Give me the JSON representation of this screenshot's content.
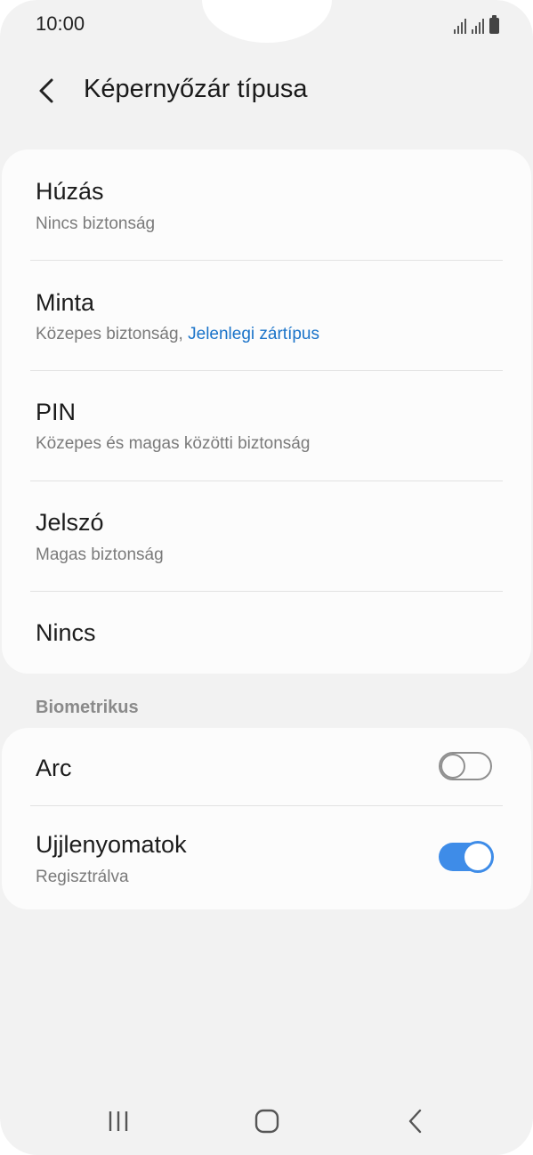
{
  "status_bar": {
    "time": "10:00"
  },
  "header": {
    "title": "Képernyőzár típusa",
    "back_icon": "chevron-left-icon"
  },
  "lock_types": [
    {
      "title": "Húzás",
      "subtitle": "Nincs biztonság",
      "subtitle_accent": ""
    },
    {
      "title": "Minta",
      "subtitle": "Közepes biztonság, ",
      "subtitle_accent": "Jelenlegi zártípus"
    },
    {
      "title": "PIN",
      "subtitle": "Közepes és magas közötti biztonság",
      "subtitle_accent": ""
    },
    {
      "title": "Jelszó",
      "subtitle": "Magas biztonság",
      "subtitle_accent": ""
    },
    {
      "title": "Nincs",
      "subtitle": "",
      "subtitle_accent": ""
    }
  ],
  "biometrics": {
    "section_label": "Biometrikus",
    "items": [
      {
        "title": "Arc",
        "subtitle": "",
        "toggle_on": false
      },
      {
        "title": "Ujjlenyomatok",
        "subtitle": "Regisztrálva",
        "toggle_on": true
      }
    ]
  },
  "nav_bar": {
    "recents_icon": "recents-icon",
    "home_icon": "home-icon",
    "back_icon": "back-icon"
  },
  "colors": {
    "accent": "#1a73c9",
    "toggle_on": "#3e8ce8",
    "background": "#f2f2f2",
    "card": "#fcfcfc"
  }
}
